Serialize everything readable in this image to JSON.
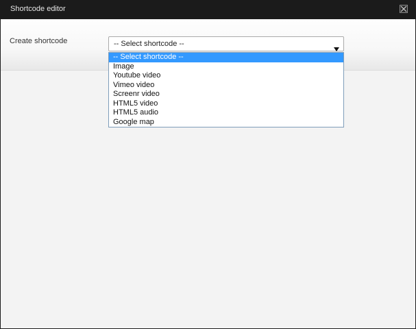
{
  "dialog": {
    "title": "Shortcode editor",
    "close_icon": "close-icon"
  },
  "form": {
    "label": "Create shortcode",
    "selected_value": "-- Select shortcode --"
  },
  "dropdown": {
    "options": [
      "-- Select shortcode --",
      "Image",
      "Youtube video",
      "Vimeo video",
      "Screenr video",
      "HTML5 video",
      "HTML5 audio",
      "Google map"
    ],
    "highlighted_index": 0
  },
  "colors": {
    "titlebar_bg": "#1b1b1b",
    "content_bg": "#f3f3f3",
    "highlight": "#3399ff",
    "dropdown_border": "#7f9db9"
  }
}
